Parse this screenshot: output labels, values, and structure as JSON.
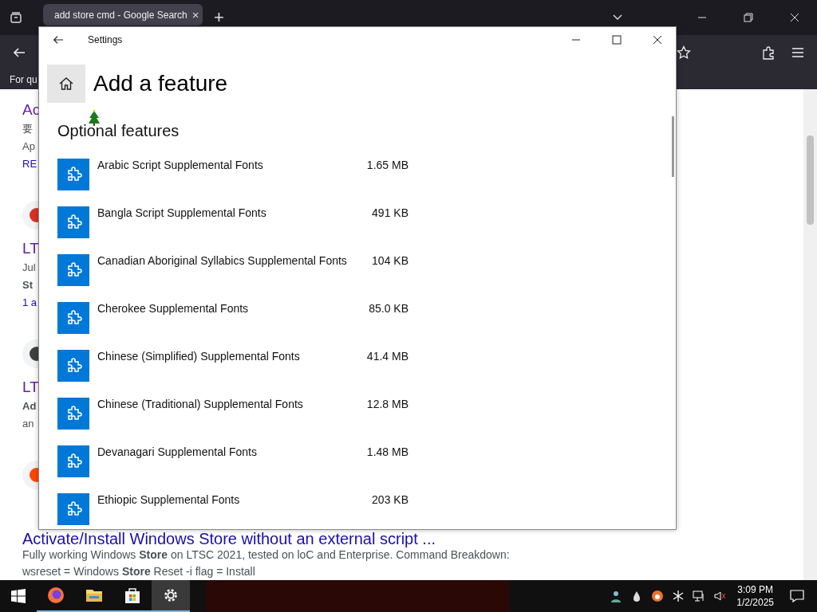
{
  "browser": {
    "tab": {
      "title": "add store cmd - Google Search",
      "close": "×",
      "selected": true
    },
    "new_tab": "+",
    "bookmark_text": "For qu",
    "fragments": [
      {
        "kind": "heading",
        "text": "Ac"
      },
      {
        "kind": "text",
        "text": "要"
      },
      {
        "kind": "text",
        "text": "Ap"
      },
      {
        "kind": "link",
        "text": "RE"
      },
      {
        "kind": "favicon",
        "color": "#d93025"
      },
      {
        "kind": "heading",
        "text": "LT"
      },
      {
        "kind": "text",
        "text": "Jul"
      },
      {
        "kind": "bold",
        "text": "St"
      },
      {
        "kind": "link",
        "text": "1 a"
      },
      {
        "kind": "favicon",
        "color": "#3c4043"
      },
      {
        "kind": "heading",
        "text": "LT"
      },
      {
        "kind": "bold",
        "text": "Ad"
      },
      {
        "kind": "text",
        "text": "an"
      },
      {
        "kind": "favicon",
        "color": "#ff4500"
      }
    ],
    "bottom_result": {
      "title": "Activate/Install Windows Store without an external script ...",
      "snippet": [
        "Fully working Windows **Store** on LTSC 2021, tested on loC and Enterprise. Command Breakdown:",
        "wsreset = Windows **Store** Reset -i flag = Install"
      ]
    }
  },
  "settings_window": {
    "title": "Settings",
    "heading": "Add a feature",
    "section": "Optional features",
    "features": [
      {
        "name": "Arabic Script Supplemental Fonts",
        "size": "1.65 MB"
      },
      {
        "name": "Bangla Script Supplemental Fonts",
        "size": "491 KB"
      },
      {
        "name": "Canadian Aboriginal Syllabics Supplemental Fonts",
        "size": "104 KB"
      },
      {
        "name": "Cherokee Supplemental Fonts",
        "size": "85.0 KB"
      },
      {
        "name": "Chinese (Simplified) Supplemental Fonts",
        "size": "41.4 MB"
      },
      {
        "name": "Chinese (Traditional) Supplemental Fonts",
        "size": "12.8 MB"
      },
      {
        "name": "Devanagari Supplemental Fonts",
        "size": "1.48 MB"
      },
      {
        "name": "Ethiopic Supplemental Fonts",
        "size": "203 KB"
      }
    ]
  },
  "taskbar": {
    "apps": [
      {
        "kind": "firefox",
        "running": true,
        "selected": false
      },
      {
        "kind": "folder",
        "running": true,
        "selected": false
      },
      {
        "kind": "store",
        "running": true,
        "selected": false
      },
      {
        "kind": "gear",
        "running": true,
        "selected": true
      }
    ],
    "time": "3:09 PM",
    "date": "1/2/2025"
  }
}
